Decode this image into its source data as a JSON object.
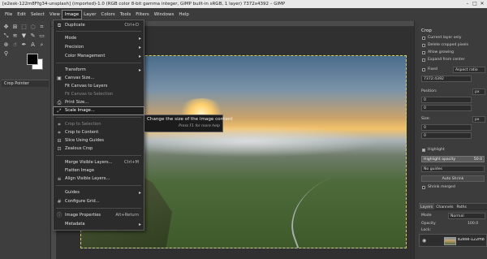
{
  "window": {
    "title": "[e2esk-122m8Ffg34-unsplash] (imported)-1.0 (RGB color 8-bit gamma integer, GIMP built-in sRGB, 1 layer) 7372x4392 – GIMP"
  },
  "menubar": [
    "File",
    "Edit",
    "Select",
    "View",
    "Image",
    "Layer",
    "Colors",
    "Tools",
    "Filters",
    "Windows",
    "Help"
  ],
  "image_menu": {
    "items": [
      {
        "label": "Duplicate",
        "shortcut": "Ctrl+D"
      },
      {
        "label": "Mode"
      },
      {
        "label": "Precision"
      },
      {
        "label": "Color Management"
      },
      {
        "label": "Transform"
      },
      {
        "label": "Canvas Size..."
      },
      {
        "label": "Fit Canvas to Layers"
      },
      {
        "label": "Fit Canvas to Selection"
      },
      {
        "label": "Print Size..."
      },
      {
        "label": "Scale Image..."
      },
      {
        "label": "Crop to Selection"
      },
      {
        "label": "Crop to Content"
      },
      {
        "label": "Slice Using Guides"
      },
      {
        "label": "Zealous Crop"
      },
      {
        "label": "Merge Visible Layers...",
        "shortcut": "Ctrl+M"
      },
      {
        "label": "Flatten Image"
      },
      {
        "label": "Align Visible Layers..."
      },
      {
        "label": "Guides"
      },
      {
        "label": "Configure Grid..."
      },
      {
        "label": "Image Properties",
        "shortcut": "Alt+Return"
      },
      {
        "label": "Metadata"
      }
    ]
  },
  "tooltip": {
    "text": "Change the size of the image content",
    "hint": "Press F1 for more help"
  },
  "toolbox": {
    "options_tab": "Crop Pointer"
  },
  "crop_panel": {
    "title": "Crop",
    "current_layer_only": "Current layer only",
    "delete_cropped": "Delete cropped pixels",
    "allow_growing": "Allow growing",
    "expand_from_center": "Expand from center",
    "fixed": "Fixed",
    "aspect": "Aspect ratio",
    "ratio_value": "7372:4392",
    "position_label": "Position:",
    "position_unit": "px",
    "pos_x": "0",
    "pos_y": "0",
    "size_label": "Size:",
    "size_unit": "px",
    "size_w": "0",
    "size_h": "0",
    "highlight": "Highlight",
    "highlight_opacity": "Highlight opacity",
    "highlight_value": "50.0",
    "guides": "No guides",
    "auto_shrink": "Auto Shrink",
    "shrink_merged": "Shrink merged"
  },
  "layers_panel": {
    "tabs": [
      "Layers",
      "Channels",
      "Paths"
    ],
    "mode_label": "Mode",
    "mode_value": "Normal",
    "opacity_label": "Opacity",
    "opacity_value": "100.0",
    "lock_label": "Lock:",
    "layer_name": "e2esk-122m8"
  }
}
